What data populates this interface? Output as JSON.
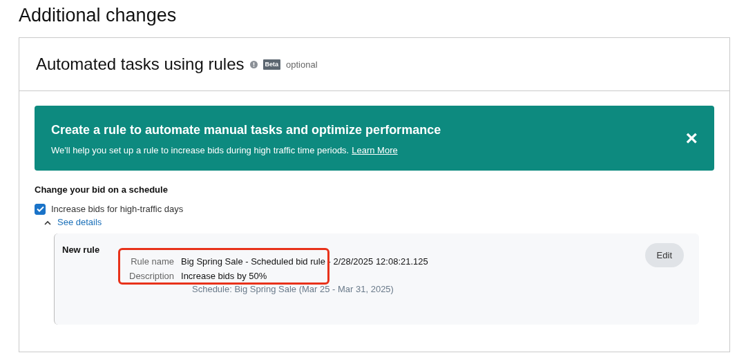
{
  "page_title": "Additional changes",
  "card": {
    "title": "Automated tasks using rules",
    "badge": "Beta",
    "optional_label": "optional"
  },
  "banner": {
    "title": "Create a rule to automate manual tasks and optimize performance",
    "text": "We'll help you set up a rule to increase bids during high traffic time periods.",
    "link": "Learn More",
    "close": "×"
  },
  "section_title": "Change your bid on a schedule",
  "option": {
    "label": "Increase bids for high-traffic days",
    "checked": true
  },
  "details_toggle": {
    "label": "See details",
    "expanded": true
  },
  "rule": {
    "heading": "New rule",
    "edit_button": "Edit",
    "highlighted": true,
    "fields": [
      {
        "label": "Rule name",
        "value": "Big Spring Sale - Scheduled bid rule - 2/28/2025 12:08:21.125"
      },
      {
        "label": "Description",
        "value": "Increase bids by 50%"
      }
    ],
    "schedule": "Schedule: Big Spring Sale (Mar 25 - Mar 31, 2025)"
  }
}
